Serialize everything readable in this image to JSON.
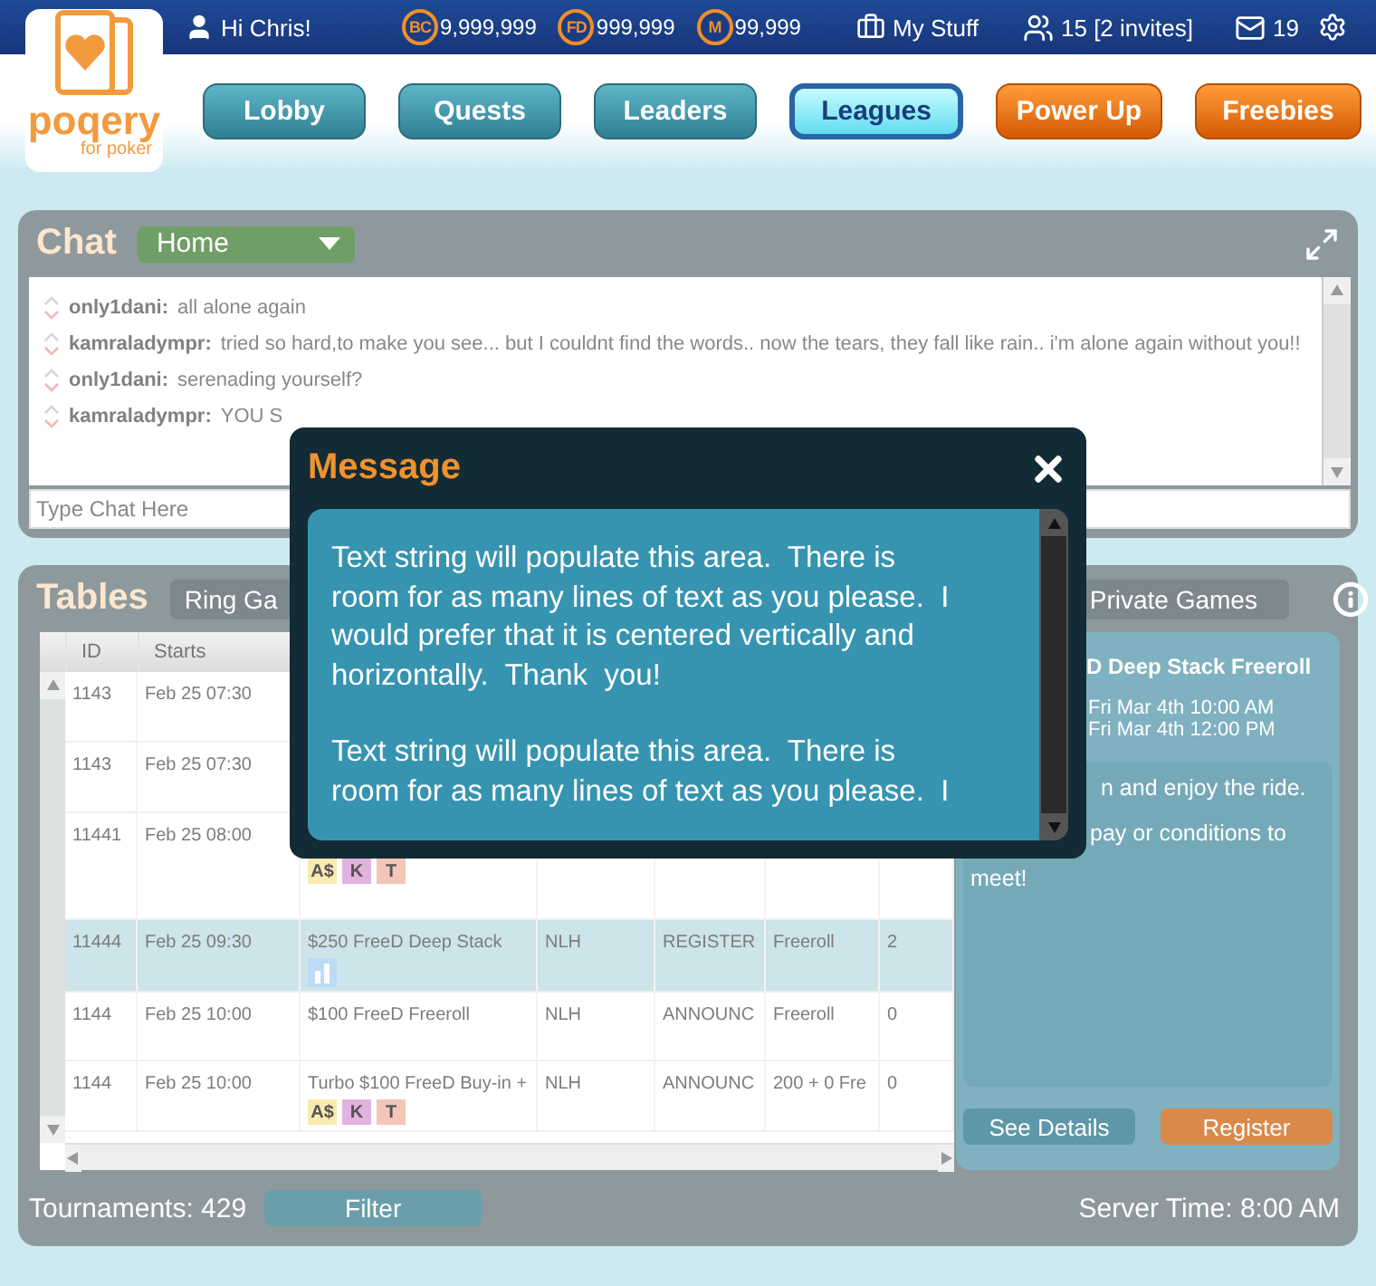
{
  "logo": {
    "name": "poqery",
    "tagline": "for poker"
  },
  "top_bar": {
    "greeting": "Hi Chris!",
    "currencies": [
      {
        "symbol": "BC",
        "amount": "9,999,999"
      },
      {
        "symbol": "FD",
        "amount": "999,999"
      },
      {
        "symbol": "M",
        "amount": "99,999"
      }
    ],
    "my_stuff": "My Stuff",
    "friends": "15 [2 invites]",
    "messages": "19"
  },
  "nav": [
    {
      "label": "Lobby",
      "kind": "teal",
      "selected": false
    },
    {
      "label": "Quests",
      "kind": "teal",
      "selected": false
    },
    {
      "label": "Leaders",
      "kind": "teal",
      "selected": false
    },
    {
      "label": "Leagues",
      "kind": "teal",
      "selected": true
    },
    {
      "label": "Power Up",
      "kind": "orange",
      "selected": false
    },
    {
      "label": "Freebies",
      "kind": "orange",
      "selected": false
    }
  ],
  "chat": {
    "title": "Chat",
    "room": "Home",
    "messages": [
      {
        "user": "only1dani:",
        "text": "all alone again"
      },
      {
        "user": "kamraladympr:",
        "text": "tried so hard,to make you see... but I couldnt find the words.. now the tears, they fall like rain.. i'm alone again without you!!"
      },
      {
        "user": "only1dani:",
        "text": "serenading yourself?"
      },
      {
        "user": "kamraladympr:",
        "text": "YOU S"
      }
    ],
    "input_placeholder": "Type Chat Here"
  },
  "tables": {
    "title": "Tables",
    "tabs": [
      {
        "label": "Ring Ga"
      },
      {
        "label": "Private Games"
      }
    ],
    "columns": [
      "ID",
      "Starts"
    ],
    "rows": [
      {
        "id": "1143",
        "starts": "Feb 25 07:30",
        "selected": false
      },
      {
        "id": "1143",
        "starts": "Feb 25 07:30",
        "selected": false
      },
      {
        "id": "11441",
        "starts": "Feb 25 08:00",
        "selected": false,
        "tags": [
          {
            "kind": "letter",
            "label": "A$",
            "color": "#f9eab0"
          },
          {
            "kind": "letter",
            "label": "K",
            "color": "#e2b3df"
          },
          {
            "kind": "letter",
            "label": "T",
            "color": "#f2c6b8"
          }
        ]
      },
      {
        "id": "11444",
        "starts": "Feb 25 09:30",
        "name": "$250 FreeD Deep Stack",
        "game": "NLH",
        "status": "REGISTER",
        "buy_in": "Freeroll",
        "entries": "2",
        "selected": true,
        "tags": [
          {
            "kind": "chart",
            "color": "#bcdcf6"
          }
        ]
      },
      {
        "id": "1144",
        "starts": "Feb 25 10:00",
        "name": "$100 FreeD Freeroll",
        "game": "NLH",
        "status": "ANNOUNC",
        "buy_in": "Freeroll",
        "entries": "0",
        "selected": false
      },
      {
        "id": "1144",
        "starts": "Feb 25 10:00",
        "name": "Turbo $100 FreeD Buy-in +",
        "game": "NLH",
        "status": "ANNOUNC",
        "buy_in": "200 + 0 Fre",
        "entries": "0",
        "selected": false,
        "tags": [
          {
            "kind": "letter",
            "label": "A$",
            "color": "#f9eab0"
          },
          {
            "kind": "letter",
            "label": "K",
            "color": "#e2b3df"
          },
          {
            "kind": "letter",
            "label": "T",
            "color": "#f2c6b8"
          }
        ]
      }
    ],
    "details": {
      "title": "D Deep Stack Freeroll",
      "times": [
        "Fri Mar 4th 10:00 AM",
        "Fri Mar 4th 12:00 PM"
      ],
      "description": [
        "n and enjoy the ride.",
        "pay or conditions to",
        "meet!"
      ],
      "see_details": "See Details",
      "register": "Register"
    },
    "tournament_count": "Tournaments: 429",
    "filter": "Filter",
    "server_time": "Server Time: 8:00 AM"
  },
  "modal": {
    "title": "Message",
    "paragraphs": [
      "Text string will populate this area.  There is\nroom for as many lines of text as you please.  I\nwould prefer that it is centered vertically and\nhorizontally.  Thank  you!",
      "Text string will populate this area.  There is\nroom for as many lines of text as you please.  I"
    ]
  }
}
